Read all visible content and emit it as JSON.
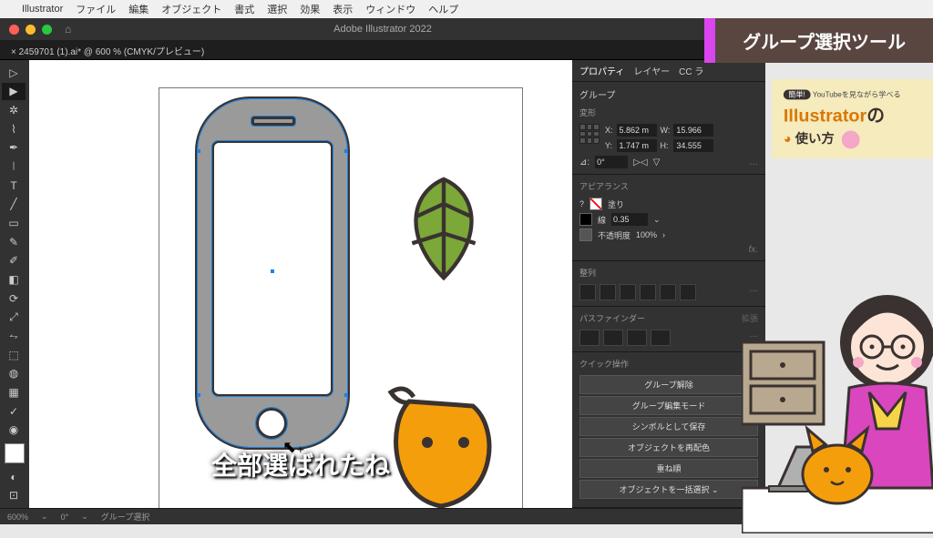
{
  "menubar": {
    "app": "Illustrator",
    "items": [
      "ファイル",
      "編集",
      "オブジェクト",
      "書式",
      "選択",
      "効果",
      "表示",
      "ウィンドウ",
      "ヘルプ"
    ]
  },
  "titlebar": {
    "title": "Adobe Illustrator 2022"
  },
  "doc_tab": "×  2459701 (1).ai* @ 600 % (CMYK/プレビュー)",
  "panel_tabs": {
    "properties": "プロパティ",
    "layers": "レイヤー",
    "cclib": "CC ラ"
  },
  "transform": {
    "section": "変形",
    "group": "グループ",
    "x_label": "X:",
    "x": "5.862 m",
    "y_label": "Y:",
    "y": "1.747 m",
    "w_label": "W:",
    "w": "15.966",
    "h_label": "H:",
    "h": "34.555",
    "angle_label": "⊿:",
    "angle": "0°"
  },
  "appearance": {
    "section": "アピアランス",
    "fill": "塗り",
    "stroke": "線",
    "stroke_width": "0.35",
    "opacity_label": "不透明度",
    "opacity": "100%"
  },
  "align": {
    "section": "整列"
  },
  "pathfinder": {
    "section": "パスファインダー",
    "expand": "拡張"
  },
  "quick": {
    "section": "クイック操作",
    "ungroup": "グループ解除",
    "edit_group": "グループ編集モード",
    "save_symbol": "シンボルとして保存",
    "recolor": "オブジェクトを再配色",
    "arrange": "重ね順",
    "select_all": "オブジェクトを一括選択"
  },
  "status": {
    "zoom": "600%",
    "angle": "0°",
    "tool": "グループ選択"
  },
  "subtitle": "全部選ばれたね",
  "overlay_title": "グループ選択ツール",
  "promo": {
    "badge": "簡単!",
    "small": "YouTubeを見ながら学べる",
    "title_main": "Illustrator",
    "title_suffix": "の",
    "subtitle": "使い方"
  }
}
